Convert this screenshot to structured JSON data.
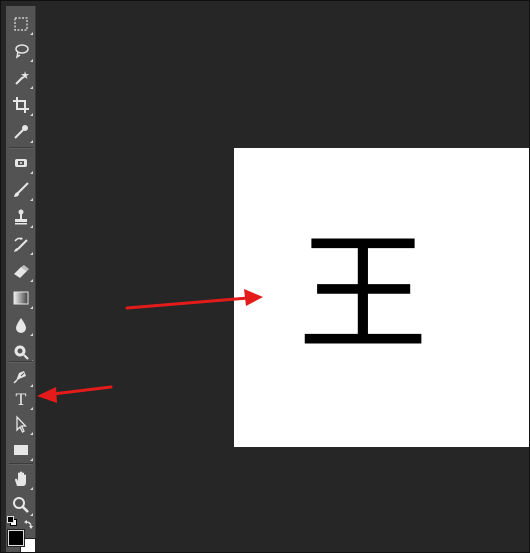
{
  "toolbar": {
    "tools": [
      {
        "name": "rectangular-marquee-icon"
      },
      {
        "name": "lasso-icon"
      },
      {
        "name": "magic-wand-icon"
      },
      {
        "name": "crop-icon"
      },
      {
        "name": "eyedropper-icon"
      },
      {
        "name": "healing-brush-icon"
      },
      {
        "name": "brush-icon"
      },
      {
        "name": "clone-stamp-icon"
      },
      {
        "name": "history-brush-icon"
      },
      {
        "name": "eraser-icon"
      },
      {
        "name": "gradient-icon"
      },
      {
        "name": "blur-icon"
      },
      {
        "name": "dodge-icon"
      },
      {
        "name": "pen-icon"
      },
      {
        "name": "type-icon",
        "glyph": "T"
      },
      {
        "name": "path-selection-icon"
      },
      {
        "name": "rectangle-shape-icon"
      },
      {
        "name": "hand-icon"
      },
      {
        "name": "zoom-icon"
      }
    ],
    "foreground_color": "#000000",
    "background_color": "#ffffff"
  },
  "canvas": {
    "text": "王",
    "background": "#ffffff",
    "text_color": "#000000"
  },
  "annotations": {
    "arrow_color": "#e31b1b",
    "arrows": [
      "arrow-to-canvas",
      "arrow-to-type-tool"
    ]
  },
  "colors": {
    "workspace": "#262626",
    "toolbar": "#535353"
  }
}
